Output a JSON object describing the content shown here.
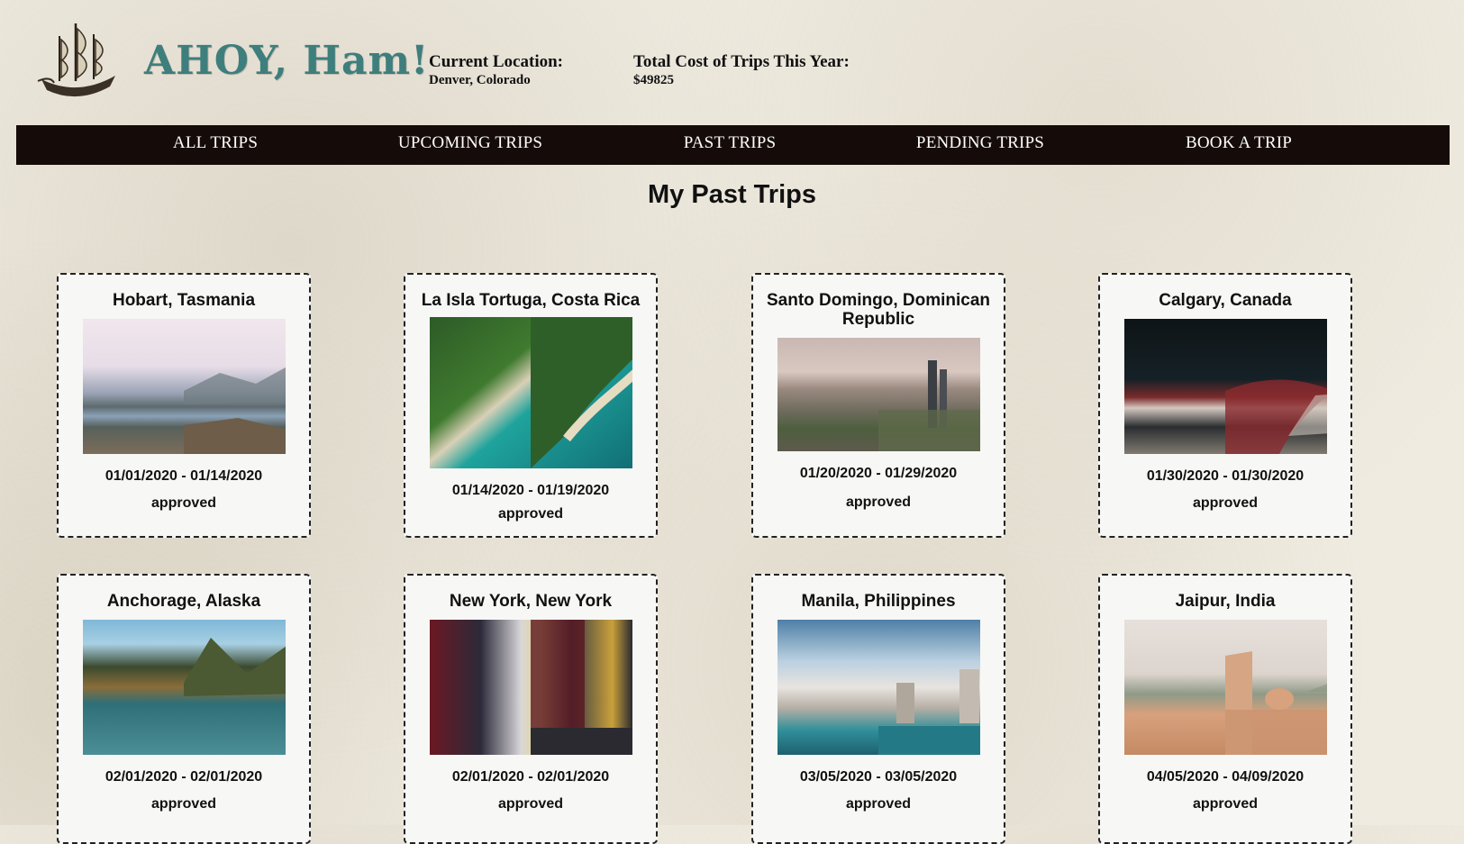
{
  "header": {
    "brand": "AHOY, Ham!",
    "location_label": "Current Location:",
    "location_value": "Denver, Colorado",
    "cost_label": "Total Cost of Trips This Year:",
    "cost_value": "$49825"
  },
  "nav": {
    "items": [
      "ALL TRIPS",
      "UPCOMING TRIPS",
      "PAST TRIPS",
      "PENDING TRIPS",
      "BOOK A TRIP"
    ]
  },
  "page_title": "My Past Trips",
  "trips": [
    {
      "destination": "Hobart, Tasmania",
      "dates": "01/01/2020 - 01/14/2020",
      "status": "approved",
      "photo": "mountain-lake-hiker"
    },
    {
      "destination": "La Isla Tortuga, Costa Rica",
      "dates": "01/14/2020 - 01/19/2020",
      "status": "approved",
      "photo": "aerial-beach-island"
    },
    {
      "destination": "Santo Domingo, Dominican Republic",
      "dates": "01/20/2020 - 01/29/2020",
      "status": "approved",
      "photo": "city-skyline-aerial"
    },
    {
      "destination": "Calgary, Canada",
      "dates": "01/30/2020 - 01/30/2020",
      "status": "approved",
      "photo": "night-bridge-city"
    },
    {
      "destination": "Anchorage, Alaska",
      "dates": "02/01/2020 - 02/01/2020",
      "status": "approved",
      "photo": "mountain-lake-kayak"
    },
    {
      "destination": "New York, New York",
      "dates": "02/01/2020 - 02/01/2020",
      "status": "approved",
      "photo": "times-square-street"
    },
    {
      "destination": "Manila, Philippines",
      "dates": "03/05/2020 - 03/05/2020",
      "status": "approved",
      "photo": "harbor-city-skyline"
    },
    {
      "destination": "Jaipur, India",
      "dates": "04/05/2020 - 04/09/2020",
      "status": "approved",
      "photo": "palace-domes"
    }
  ],
  "colors": {
    "brand": "#3e7e7c",
    "nav_bg": "#150b08",
    "card_bg": "#f7f7f6"
  }
}
